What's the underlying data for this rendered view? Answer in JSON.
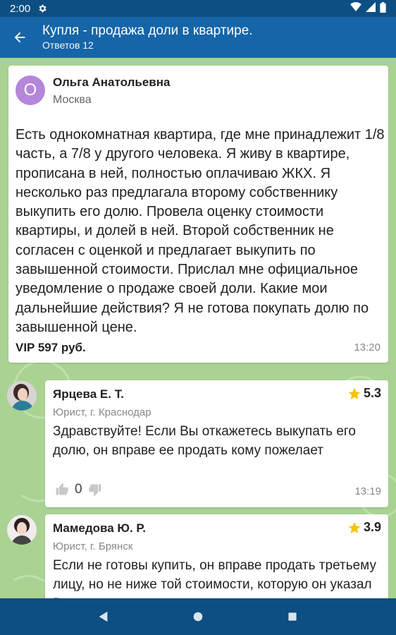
{
  "status": {
    "time": "2:00"
  },
  "appbar": {
    "title": "Купля - продажа доли в квартире.",
    "subtitle": "Ответов 12"
  },
  "question": {
    "avatar_letter": "О",
    "author": "Ольга Анатольевна",
    "city": "Москва",
    "text": "Есть однокомнатная квартира, где мне принадлежит 1/8 часть, а 7/8 у другого человека. Я живу в квартире, прописана в ней, полностью оплачиваю ЖКХ. Я несколько раз предлагала второму собственнику выкупить его долю. Провела оценку стоимости квартиры, и долей в ней. Второй собственник не согласен с оценкой и предлагает выкупить по завышенной стоимости. Прислал мне официальное уведомление о продаже своей доли. Какие мои дальнейшие действия? Я не готова покупать долю по завышенной цене.",
    "price": "VIP 597 руб.",
    "time": "13:20",
    "avatar_color": "#b586d9"
  },
  "answers": [
    {
      "name": "Ярцева Е. Т.",
      "rating": "5.3",
      "role": "Юрист, г. Краснодар",
      "text": "Здравствуйте! Если Вы откажетесь выкупать его долю, он вправе ее продать кому пожелает",
      "likes": "0",
      "time": "13:19"
    },
    {
      "name": "Мамедова Ю. Р.",
      "rating": "3.9",
      "role": "Юрист, г. Брянск",
      "text": "Если не готовы купить, он вправе продать третьему лицу, но не ниже той стоимости, которую он указал Вам"
    }
  ],
  "colors": {
    "statusbar": "#0d4f82",
    "appbar": "#1565a8",
    "background": "#a9d293",
    "star": "#f5c400"
  },
  "icons": [
    "settings-icon",
    "wifi-icon",
    "signal-icon",
    "battery-icon",
    "back-arrow-icon",
    "star-icon",
    "thumb-up-icon",
    "thumb-down-icon",
    "nav-back-icon",
    "nav-home-icon",
    "nav-recents-icon"
  ]
}
